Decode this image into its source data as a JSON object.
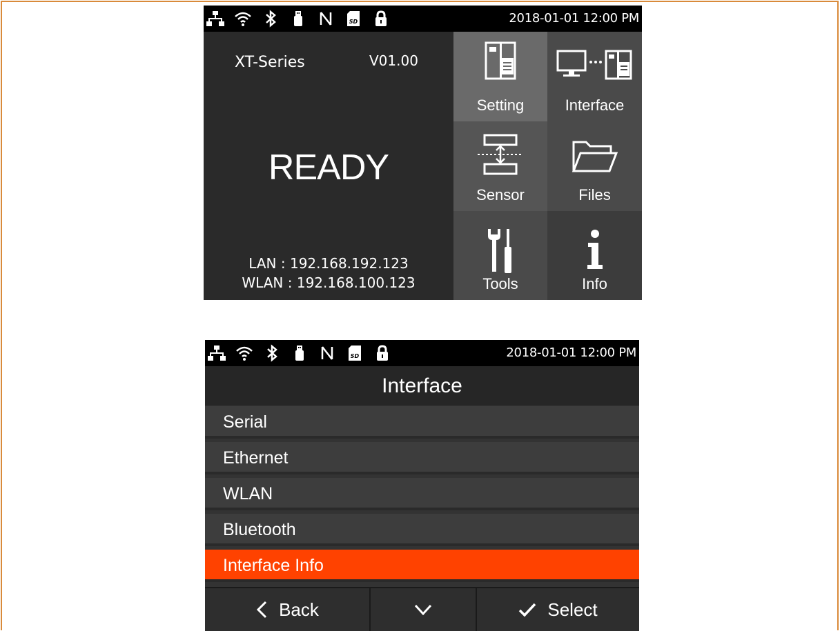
{
  "status_bar": {
    "icons": [
      "ethernet-icon",
      "wifi-icon",
      "bluetooth-icon",
      "usb-icon",
      "nfc-icon",
      "sd-card-icon",
      "lock-icon"
    ],
    "datetime": "2018-01-01 12:00 PM"
  },
  "home": {
    "model": "XT-Series",
    "version": "V01.00",
    "status": "READY",
    "lan": "LAN : 192.168.192.123",
    "wlan": "WLAN : 192.168.100.123",
    "tiles": [
      {
        "label": "Setting",
        "icon": "printer-setting-icon"
      },
      {
        "label": "Interface",
        "icon": "pc-printer-icon"
      },
      {
        "label": "Sensor",
        "icon": "sensor-icon"
      },
      {
        "label": "Files",
        "icon": "folder-icon"
      },
      {
        "label": "Tools",
        "icon": "tools-icon"
      },
      {
        "label": "Info",
        "icon": "info-icon"
      }
    ]
  },
  "interface_screen": {
    "title": "Interface",
    "items": [
      "Serial",
      "Ethernet",
      "WLAN",
      "Bluetooth",
      "Interface Info"
    ],
    "selected_index": 4,
    "back_label": "Back",
    "select_label": "Select"
  },
  "colors": {
    "accent": "#ff4200",
    "frame_border": "#d98a3a"
  }
}
